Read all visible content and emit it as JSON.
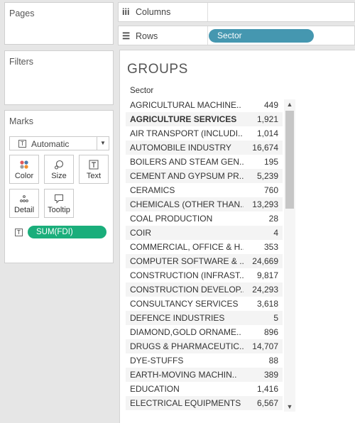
{
  "cards": {
    "pages_title": "Pages",
    "filters_title": "Filters",
    "marks_title": "Marks",
    "mark_type": "Automatic",
    "mark_buttons": [
      {
        "label": "Color"
      },
      {
        "label": "Size"
      },
      {
        "label": "Text"
      },
      {
        "label": "Detail"
      },
      {
        "label": "Tooltip"
      }
    ],
    "measure_pill": "SUM(FDI)"
  },
  "shelves": {
    "columns_label": "Columns",
    "rows_label": "Rows",
    "rows_pill": "Sector"
  },
  "view": {
    "title": "GROUPS",
    "column_header": "Sector",
    "rows": [
      {
        "label": "AGRICULTURAL MACHINE..",
        "value": "449"
      },
      {
        "label": "AGRICULTURE SERVICES",
        "value": "1,921"
      },
      {
        "label": "AIR TRANSPORT (INCLUDI..",
        "value": "1,014"
      },
      {
        "label": "AUTOMOBILE INDUSTRY",
        "value": "16,674"
      },
      {
        "label": "BOILERS AND STEAM GEN..",
        "value": "195"
      },
      {
        "label": "CEMENT AND GYPSUM PR..",
        "value": "5,239"
      },
      {
        "label": "CERAMICS",
        "value": "760"
      },
      {
        "label": "CHEMICALS (OTHER THAN..",
        "value": "13,293"
      },
      {
        "label": "COAL PRODUCTION",
        "value": "28"
      },
      {
        "label": "COIR",
        "value": "4"
      },
      {
        "label": "COMMERCIAL, OFFICE & H..",
        "value": "353"
      },
      {
        "label": "COMPUTER SOFTWARE & ..",
        "value": "24,669"
      },
      {
        "label": "CONSTRUCTION (INFRAST..",
        "value": "9,817"
      },
      {
        "label": "CONSTRUCTION DEVELOP..",
        "value": "24,293"
      },
      {
        "label": "CONSULTANCY SERVICES",
        "value": "3,618"
      },
      {
        "label": "DEFENCE INDUSTRIES",
        "value": "5"
      },
      {
        "label": "DIAMOND,GOLD ORNAME..",
        "value": "896"
      },
      {
        "label": "DRUGS & PHARMACEUTIC..",
        "value": "14,707"
      },
      {
        "label": "DYE-STUFFS",
        "value": "88"
      },
      {
        "label": "EARTH-MOVING MACHIN..",
        "value": "389"
      },
      {
        "label": "EDUCATION",
        "value": "1,416"
      },
      {
        "label": "ELECTRICAL EQUIPMENTS",
        "value": "6,567"
      }
    ]
  },
  "colors": {
    "rows_pill": "#4597b0",
    "measure_pill": "#1aae7b"
  }
}
